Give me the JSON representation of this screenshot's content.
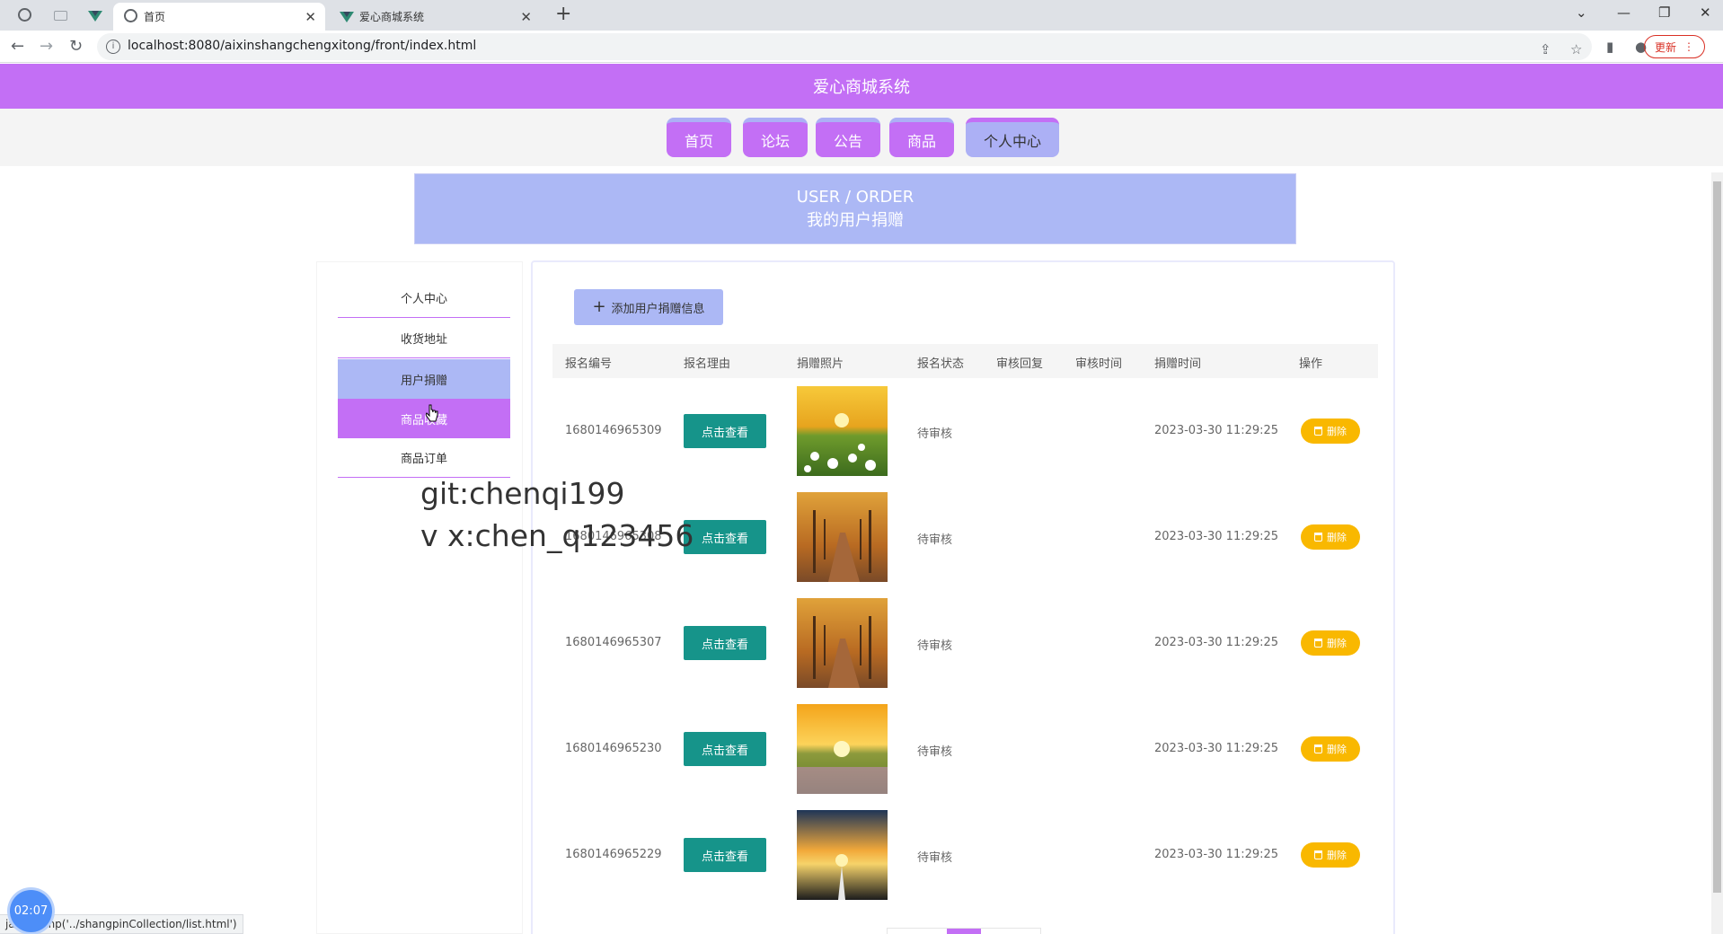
{
  "browser": {
    "tabs": [
      {
        "title": "首页",
        "active": true
      },
      {
        "title": "爱心商城系统",
        "active": false
      }
    ],
    "url": "localhost:8080/aixinshangchengxitong/front/index.html",
    "update_label": "更新",
    "status_text": "ja...,cjump('../shangpinCollection/list.html')"
  },
  "site": {
    "title": "爱心商城系统",
    "nav": [
      {
        "label": "首页"
      },
      {
        "label": "论坛"
      },
      {
        "label": "公告"
      },
      {
        "label": "商品"
      },
      {
        "label": "个人中心"
      }
    ],
    "banner_en": "USER / ORDER",
    "banner_cn": "我的用户捐赠"
  },
  "sidebar": {
    "items": [
      {
        "label": "个人中心"
      },
      {
        "label": "收货地址"
      },
      {
        "label": "用户捐赠"
      },
      {
        "label": "商品收藏"
      },
      {
        "label": "商品订单"
      }
    ]
  },
  "main": {
    "add_button": "添加用户捐赠信息",
    "columns": [
      "报名编号",
      "报名理由",
      "捐赠照片",
      "报名状态",
      "审核回复",
      "审核时间",
      "捐赠时间",
      "操作"
    ],
    "view_label": "点击查看",
    "delete_label": "删除",
    "rows": [
      {
        "id": "1680146965309",
        "status": "待审核",
        "reply": "",
        "review_time": "",
        "donate_time": "2023-03-30 11:29:25",
        "photo": "flowers-field"
      },
      {
        "id": "1680146965308",
        "status": "待审核",
        "reply": "",
        "review_time": "",
        "donate_time": "2023-03-30 11:29:25",
        "photo": "autumn-road"
      },
      {
        "id": "1680146965307",
        "status": "待审核",
        "reply": "",
        "review_time": "",
        "donate_time": "2023-03-30 11:29:25",
        "photo": "autumn-road"
      },
      {
        "id": "1680146965230",
        "status": "待审核",
        "reply": "",
        "review_time": "",
        "donate_time": "2023-03-30 11:29:25",
        "photo": "sunset-meadow"
      },
      {
        "id": "1680146965229",
        "status": "待审核",
        "reply": "",
        "review_time": "",
        "donate_time": "2023-03-30 11:29:25",
        "photo": "sunset-road"
      }
    ]
  },
  "overlay": {
    "watermark_line1": "git:chenqi199",
    "watermark_line2": "v x:chen_q123456",
    "timer": "02:07"
  },
  "colors": {
    "primary": "#c36ff5",
    "secondary": "#acb8f5",
    "view_button": "#16948a",
    "delete_button": "#f9b800"
  }
}
